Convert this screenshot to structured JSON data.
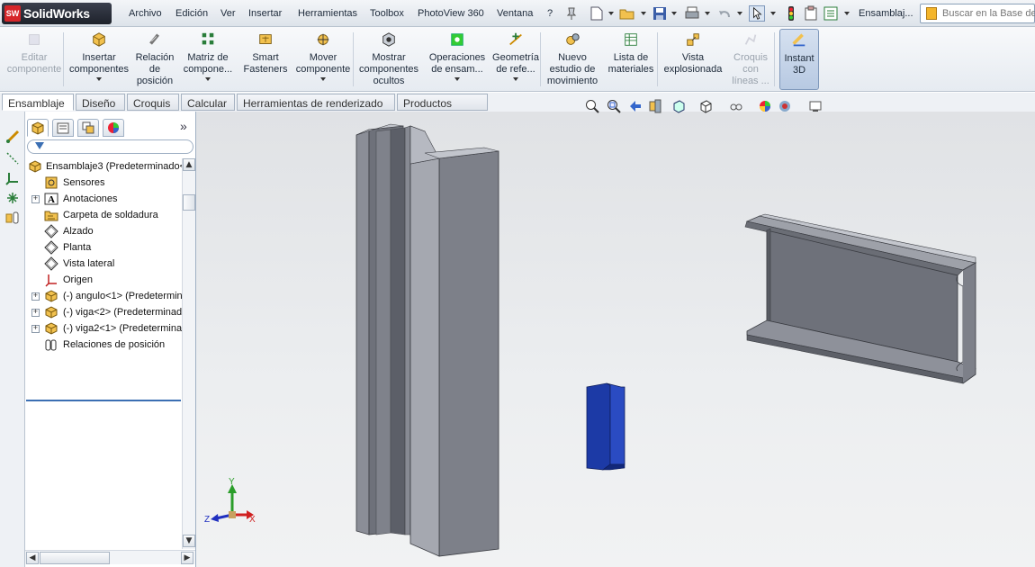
{
  "app": {
    "logo_badge": "SW",
    "logo_text": "SolidWorks"
  },
  "menu": [
    "Archivo",
    "Edición",
    "Ver",
    "Insertar",
    "Herramientas",
    "Toolbox",
    "PhotoView 360",
    "Ventana",
    "?"
  ],
  "document_title": "Ensamblaj...",
  "search": {
    "placeholder": "Buscar en la Base de"
  },
  "ribbon": [
    {
      "label": "Editar\ncomponente",
      "icon": "edit-component-icon",
      "disabled": true,
      "dropdown": false
    },
    {
      "label": "Insertar\ncomponentes",
      "icon": "insert-components-icon",
      "disabled": false,
      "dropdown": true
    },
    {
      "label": "Relación\nde\nposición",
      "icon": "mate-icon",
      "disabled": false,
      "dropdown": false
    },
    {
      "label": "Matriz de\ncompone...",
      "icon": "component-pattern-icon",
      "disabled": false,
      "dropdown": true
    },
    {
      "label": "Smart\nFasteners",
      "icon": "smart-fasteners-icon",
      "disabled": false,
      "dropdown": false
    },
    {
      "label": "Mover\ncomponente",
      "icon": "move-component-icon",
      "disabled": false,
      "dropdown": true
    },
    {
      "label": "Mostrar\ncomponentes\nocultos",
      "icon": "show-hidden-components-icon",
      "disabled": false,
      "dropdown": false
    },
    {
      "label": "Operaciones\nde ensam...",
      "icon": "assembly-features-icon",
      "disabled": false,
      "dropdown": true
    },
    {
      "label": "Geometría\nde refe...",
      "icon": "reference-geometry-icon",
      "disabled": false,
      "dropdown": true
    },
    {
      "label": "Nuevo\nestudio de\nmovimiento",
      "icon": "new-motion-study-icon",
      "disabled": false,
      "dropdown": false
    },
    {
      "label": "Lista de\nmateriales",
      "icon": "bill-of-materials-icon",
      "disabled": false,
      "dropdown": false
    },
    {
      "label": "Vista\nexplosionada",
      "icon": "exploded-view-icon",
      "disabled": false,
      "dropdown": false
    },
    {
      "label": "Croquis\ncon\nlíneas ...",
      "icon": "explode-line-sketch-icon",
      "disabled": true,
      "dropdown": false
    },
    {
      "label": "Instant\n3D",
      "icon": "instant-3d-icon",
      "disabled": false,
      "dropdown": false,
      "active": true
    }
  ],
  "tabs": [
    {
      "label": "Ensamblaje",
      "active": true
    },
    {
      "label": "Diseño",
      "active": false
    },
    {
      "label": "Croquis",
      "active": false
    },
    {
      "label": "Calcular",
      "active": false
    },
    {
      "label": "Herramientas de renderizado",
      "active": false
    },
    {
      "label": "Productos Office",
      "active": false
    }
  ],
  "tree": {
    "root": "Ensamblaje3  (Predeterminado<",
    "items": [
      {
        "label": "Sensores",
        "icon": "sensors-icon",
        "expandable": false
      },
      {
        "label": "Anotaciones",
        "icon": "annotations-icon",
        "expandable": true
      },
      {
        "label": "Carpeta de soldadura",
        "icon": "weld-folder-icon",
        "expandable": false
      },
      {
        "label": "Alzado",
        "icon": "plane-icon",
        "expandable": false
      },
      {
        "label": "Planta",
        "icon": "plane-icon",
        "expandable": false
      },
      {
        "label": "Vista lateral",
        "icon": "plane-icon",
        "expandable": false
      },
      {
        "label": "Origen",
        "icon": "origin-icon",
        "expandable": false
      },
      {
        "label": "(-) angulo<1> (Predetermin",
        "icon": "part-icon",
        "expandable": true
      },
      {
        "label": "(-) viga<2> (Predeterminad",
        "icon": "part-icon",
        "expandable": true
      },
      {
        "label": "(-) viga2<1> (Predetermina",
        "icon": "part-icon",
        "expandable": true
      },
      {
        "label": "Relaciones de posición",
        "icon": "mates-folder-icon",
        "expandable": false
      }
    ]
  },
  "triad": {
    "x": "X",
    "y": "Y",
    "z": "Z"
  },
  "colors": {
    "beam": "#7d8089",
    "beam_dark": "#5a5d66",
    "angle": "#1c3aa6",
    "accent": "#3b6fb3"
  }
}
